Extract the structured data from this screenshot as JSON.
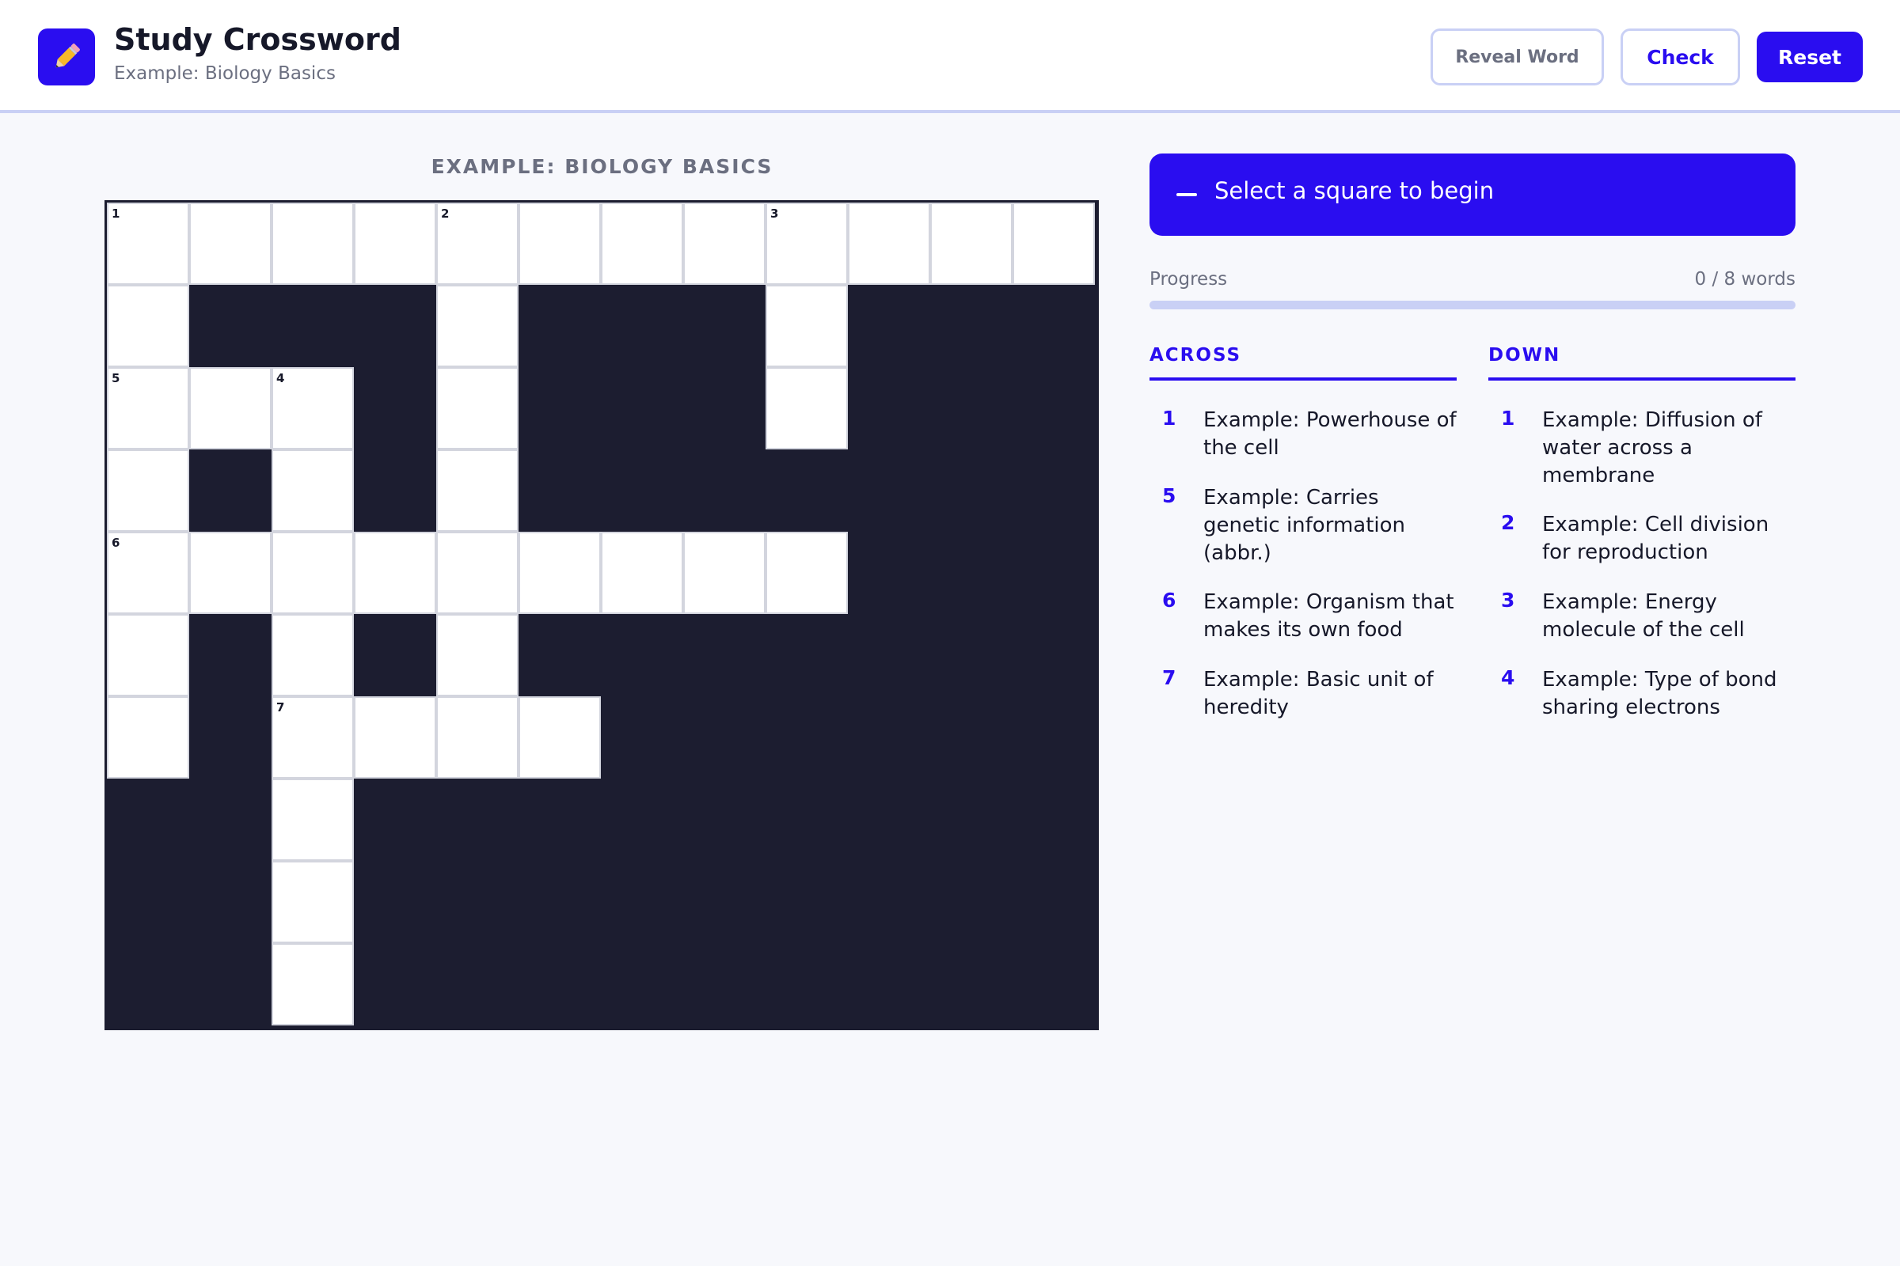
{
  "header": {
    "title": "Study Crossword",
    "subtitle": "Example: Biology Basics",
    "logo_icon": "pencil-icon",
    "buttons": {
      "reveal_label": "Reveal Word",
      "check_label": "Check",
      "reset_label": "Reset"
    }
  },
  "puzzle": {
    "title": "EXAMPLE: BIOLOGY BASICS",
    "rows": 10,
    "cols": 12,
    "open_cells": [
      [
        0,
        0,
        "1"
      ],
      [
        0,
        1,
        ""
      ],
      [
        0,
        2,
        ""
      ],
      [
        0,
        3,
        ""
      ],
      [
        0,
        4,
        "2"
      ],
      [
        0,
        5,
        ""
      ],
      [
        0,
        6,
        ""
      ],
      [
        0,
        7,
        ""
      ],
      [
        0,
        8,
        "3"
      ],
      [
        0,
        9,
        ""
      ],
      [
        0,
        10,
        ""
      ],
      [
        0,
        11,
        ""
      ],
      [
        1,
        0,
        ""
      ],
      [
        1,
        4,
        ""
      ],
      [
        1,
        8,
        ""
      ],
      [
        2,
        0,
        "5"
      ],
      [
        2,
        1,
        ""
      ],
      [
        2,
        2,
        "4"
      ],
      [
        2,
        4,
        ""
      ],
      [
        2,
        8,
        ""
      ],
      [
        3,
        0,
        ""
      ],
      [
        3,
        2,
        ""
      ],
      [
        3,
        4,
        ""
      ],
      [
        4,
        0,
        "6"
      ],
      [
        4,
        1,
        ""
      ],
      [
        4,
        2,
        ""
      ],
      [
        4,
        3,
        ""
      ],
      [
        4,
        4,
        ""
      ],
      [
        4,
        5,
        ""
      ],
      [
        4,
        6,
        ""
      ],
      [
        4,
        7,
        ""
      ],
      [
        4,
        8,
        ""
      ],
      [
        5,
        0,
        ""
      ],
      [
        5,
        2,
        ""
      ],
      [
        5,
        4,
        ""
      ],
      [
        6,
        0,
        ""
      ],
      [
        6,
        2,
        "7"
      ],
      [
        6,
        3,
        ""
      ],
      [
        6,
        4,
        ""
      ],
      [
        6,
        5,
        ""
      ],
      [
        7,
        2,
        ""
      ],
      [
        8,
        2,
        ""
      ],
      [
        9,
        2,
        ""
      ]
    ]
  },
  "status": {
    "banner_text": "Select a square to begin",
    "progress_label": "Progress",
    "progress_count": "0 / 8 words",
    "progress_value": 0
  },
  "clues": {
    "across_heading": "ACROSS",
    "down_heading": "DOWN",
    "across": [
      {
        "num": "1",
        "text": "Example: Powerhouse of the cell"
      },
      {
        "num": "5",
        "text": "Example: Carries genetic information (abbr.)"
      },
      {
        "num": "6",
        "text": "Example: Organism that makes its own food"
      },
      {
        "num": "7",
        "text": "Example: Basic unit of heredity"
      }
    ],
    "down": [
      {
        "num": "1",
        "text": "Example: Diffusion of water across a membrane"
      },
      {
        "num": "2",
        "text": "Example: Cell division for reproduction"
      },
      {
        "num": "3",
        "text": "Example: Energy molecule of the cell"
      },
      {
        "num": "4",
        "text": "Example: Type of bond sharing electrons"
      }
    ]
  },
  "colors": {
    "accent": "#2a0df0",
    "block": "#1c1d30",
    "track": "#c9d0f5"
  }
}
